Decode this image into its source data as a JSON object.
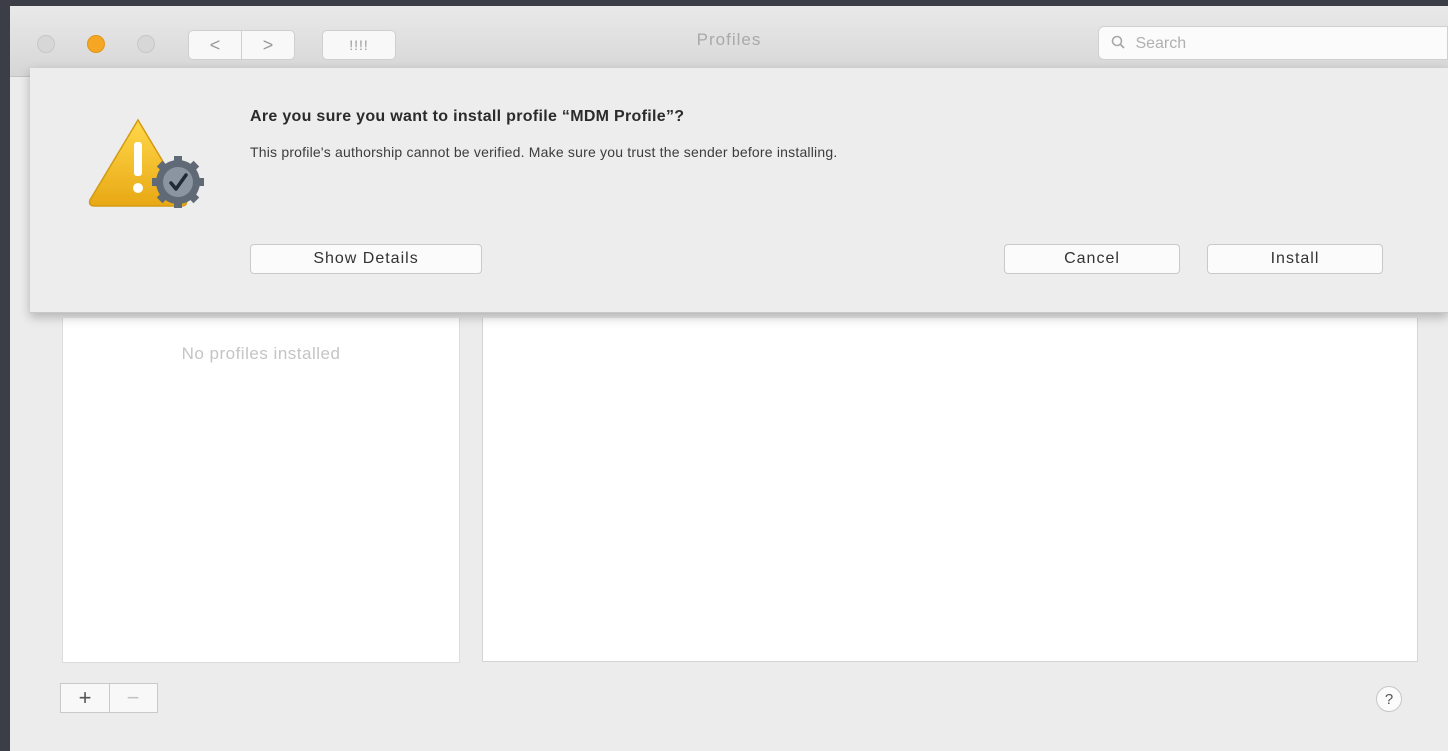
{
  "window": {
    "title": "Profiles",
    "nav": {
      "back_glyph": "<",
      "forward_glyph": ">",
      "grid_glyph": "!!!!"
    },
    "search": {
      "placeholder": "Search",
      "icon": "magnifier-icon"
    },
    "traffic_light_colors": {
      "minimize": "#f5a623"
    }
  },
  "dialog": {
    "icon": "warning-triangle-with-gear-icon",
    "heading": "Are you sure you want to install profile “MDM Profile”?",
    "message": "This profile's authorship cannot be verified. Make sure you trust the sender before installing.",
    "buttons": {
      "details": "Show Details",
      "cancel": "Cancel",
      "install": "Install"
    }
  },
  "sidebar": {
    "empty_text": "No profiles installed"
  },
  "footer": {
    "add_label": "+",
    "remove_label": "−",
    "help_label": "?"
  }
}
